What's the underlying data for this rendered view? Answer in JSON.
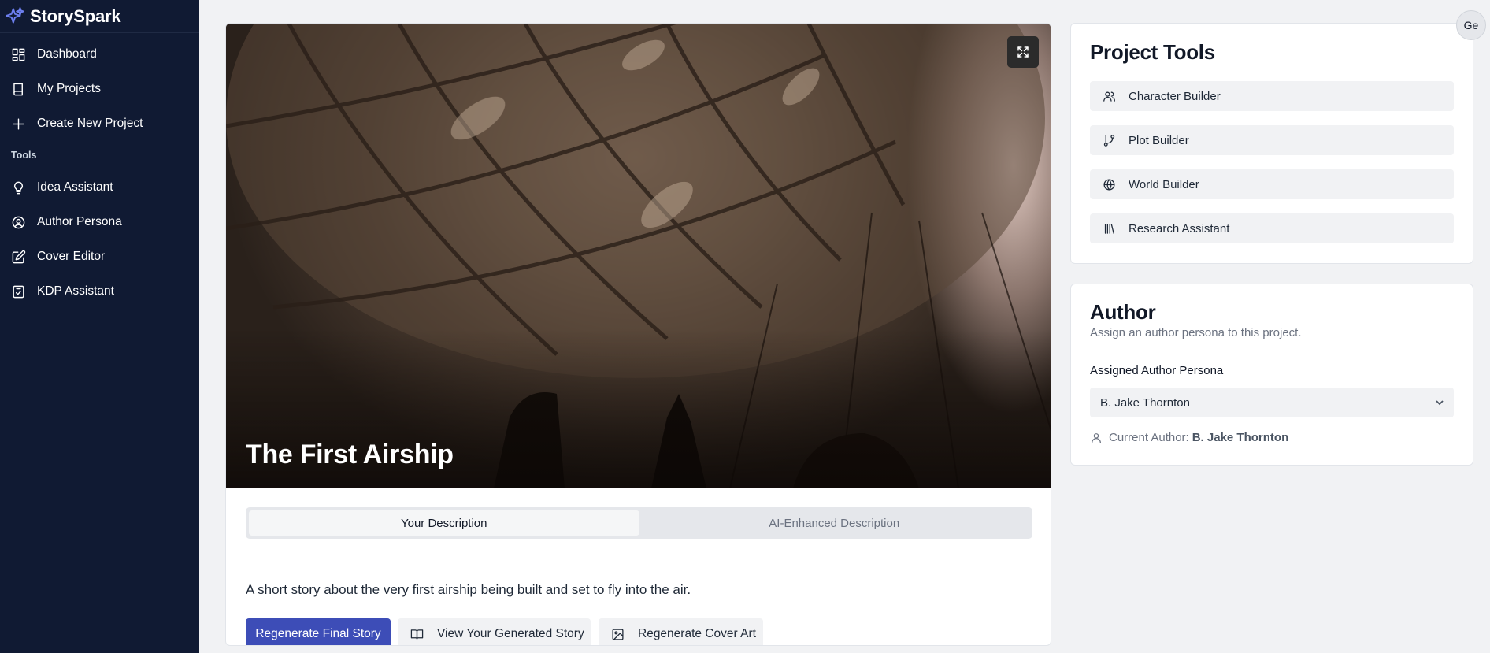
{
  "app": {
    "name": "StorySpark",
    "logo_icon": "sparkles-icon",
    "accent": "#3d4db7",
    "sidebar_bg": "#101a33"
  },
  "sidebar": {
    "items": [
      {
        "label": "Dashboard",
        "icon": "grid-icon"
      },
      {
        "label": "My Projects",
        "icon": "book-icon"
      },
      {
        "label": "Create New Project",
        "icon": "plus-icon"
      }
    ],
    "section_label": "Tools",
    "tools": [
      {
        "label": "Idea Assistant",
        "icon": "lightbulb-icon"
      },
      {
        "label": "Author Persona",
        "icon": "user-circle-icon"
      },
      {
        "label": "Cover Editor",
        "icon": "edit-icon"
      },
      {
        "label": "KDP Assistant",
        "icon": "clipboard-check-icon"
      }
    ]
  },
  "project": {
    "title": "The First Airship",
    "tabs": [
      {
        "label": "Your Description",
        "active": true
      },
      {
        "label": "AI-Enhanced Description",
        "active": false
      }
    ],
    "description": "A short story about the very first airship being built and set to fly into the air.",
    "actions": {
      "regenerate_story": "Regenerate Final Story",
      "view_story": "View Your Generated Story",
      "regenerate_cover": "Regenerate Cover Art"
    }
  },
  "project_tools": {
    "title": "Project Tools",
    "items": [
      {
        "label": "Character Builder",
        "icon": "users-icon"
      },
      {
        "label": "Plot Builder",
        "icon": "git-branch-icon"
      },
      {
        "label": "World Builder",
        "icon": "globe-icon"
      },
      {
        "label": "Research Assistant",
        "icon": "library-icon"
      }
    ]
  },
  "author": {
    "title": "Author",
    "subtitle": "Assign an author persona to this project.",
    "field_label": "Assigned Author Persona",
    "selected": "B. Jake Thornton",
    "current_prefix": "Current Author:",
    "current_name": "B. Jake Thornton"
  },
  "user": {
    "avatar_text": "Ge"
  }
}
